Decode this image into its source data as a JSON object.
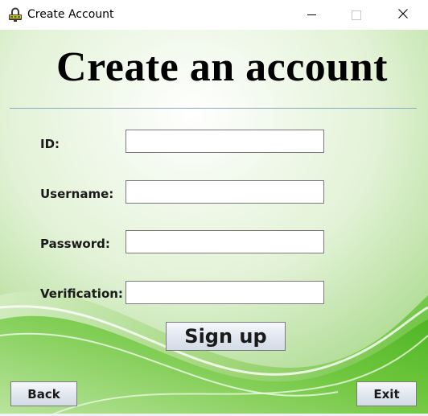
{
  "window": {
    "title": "Create Account",
    "app_icon": "lock-computer-icon",
    "controls": {
      "minimize_icon": "minimize-icon",
      "maximize_icon": "maximize-icon",
      "close_icon": "close-icon"
    }
  },
  "form": {
    "heading": "Create an account",
    "fields": [
      {
        "label": "ID:",
        "value": ""
      },
      {
        "label": "Username:",
        "value": ""
      },
      {
        "label": "Password:",
        "value": ""
      },
      {
        "label": "Verification:",
        "value": ""
      }
    ],
    "signup_label": "Sign up"
  },
  "footer": {
    "back_label": "Back",
    "exit_label": "Exit"
  },
  "colors": {
    "background_light": "#f3faee",
    "background_green": "#7cc94a",
    "divider": "#8aa8c0",
    "button_face": "#dfe5ee"
  }
}
